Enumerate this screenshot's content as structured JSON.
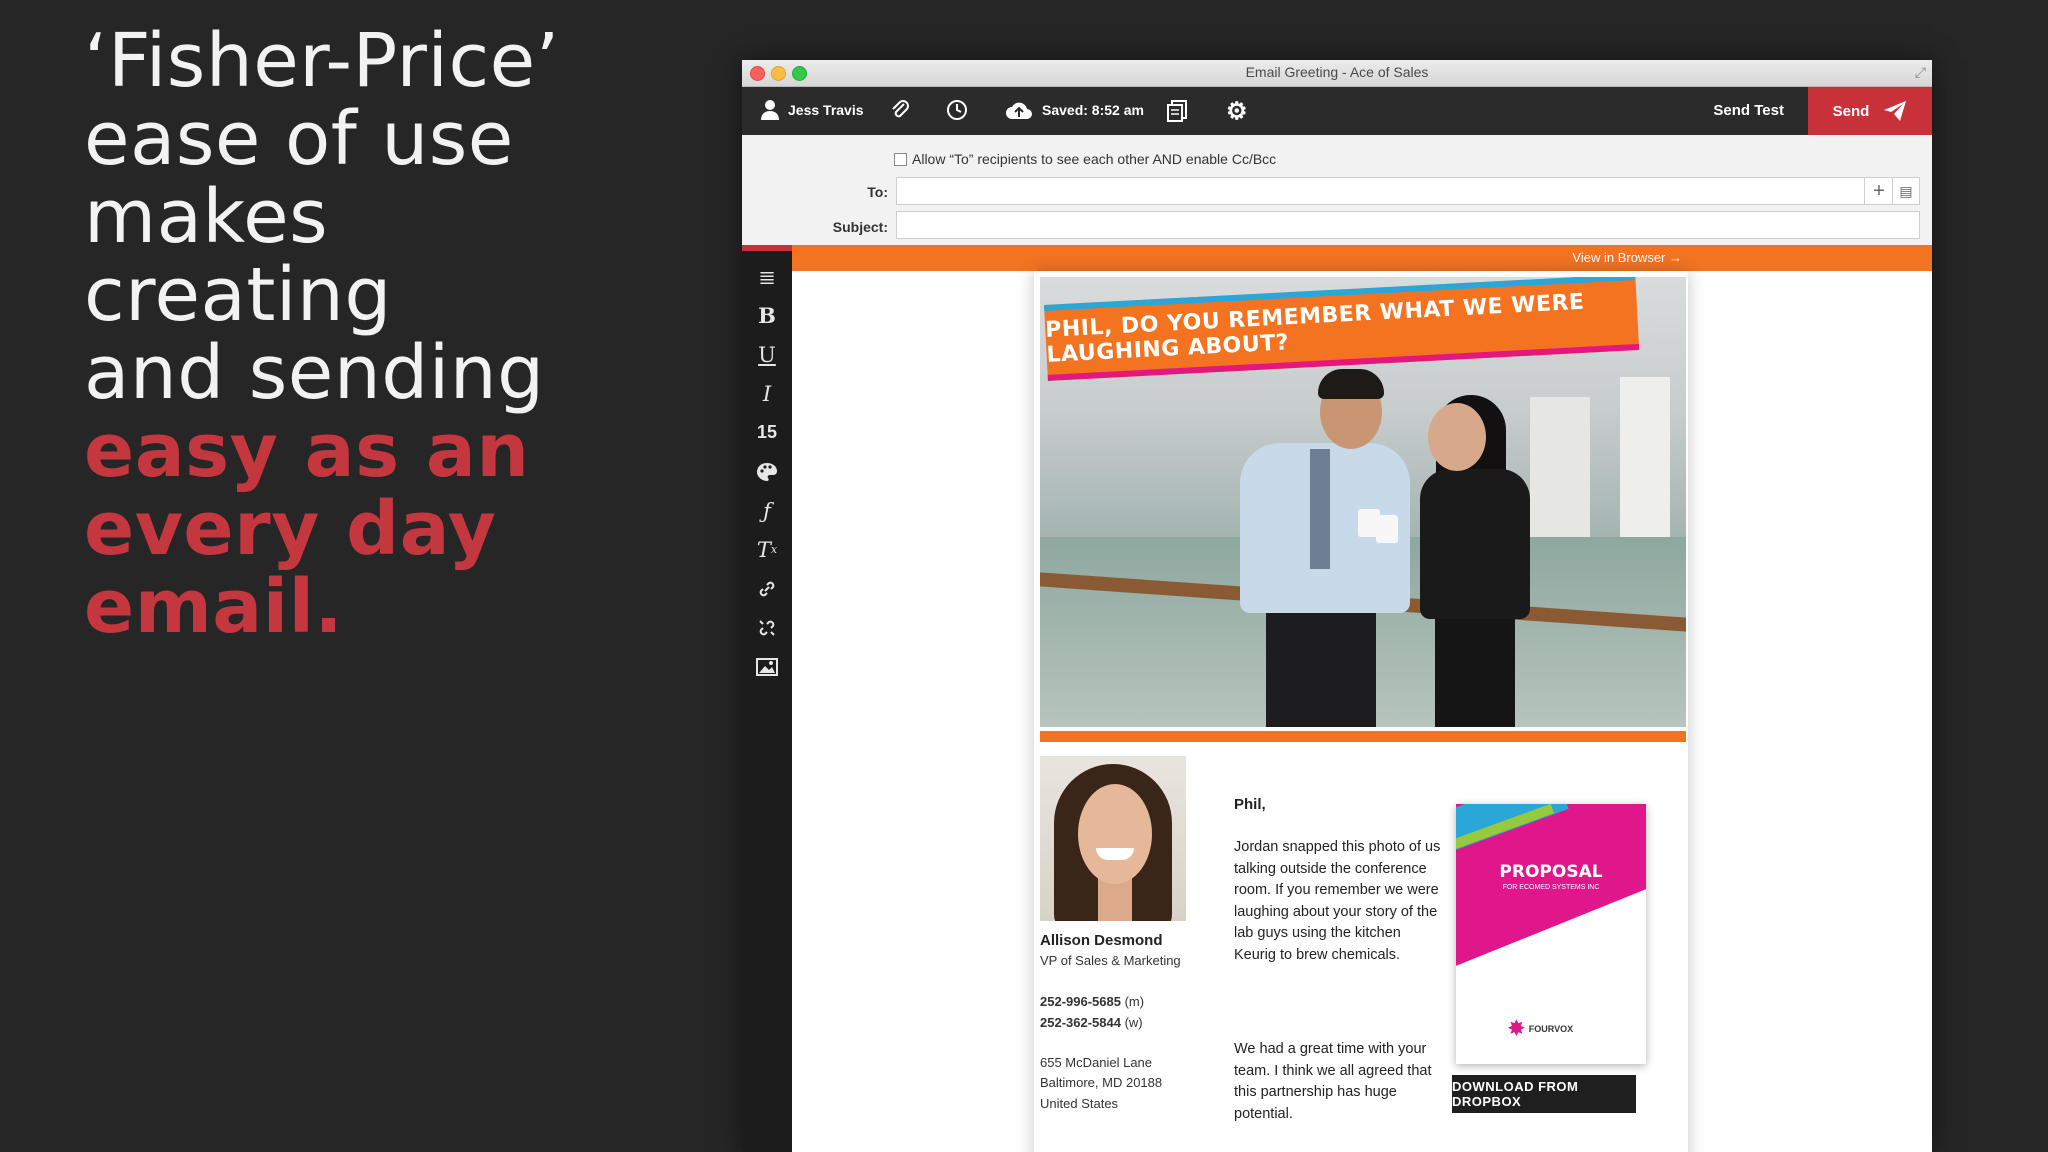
{
  "slide": {
    "lines": [
      "‘Fisher-Price’",
      "ease of use",
      "makes",
      "creating",
      "and sending"
    ],
    "accent_lines": [
      "easy as an",
      "every day",
      "email."
    ],
    "accent_color": "#c4373f"
  },
  "window": {
    "title": "Email Greeting - Ace of Sales"
  },
  "toolbar": {
    "user_name": "Jess Travis",
    "saved_label": "Saved: 8:52 am",
    "send_test_label": "Send Test",
    "send_label": "Send",
    "send_color": "#c8313a"
  },
  "fields": {
    "allow_text": "Allow “To” recipients to see each other AND enable Cc/Bcc",
    "to_label": "To:",
    "subject_label": "Subject:",
    "to_value": "",
    "subject_value": ""
  },
  "editor": {
    "view_in_browser": "View in Browser →",
    "font_size": "15",
    "accent_color": "#f47321",
    "sidebar_icons": [
      "align-icon",
      "bold-icon",
      "underline-icon",
      "italic-icon",
      "font-size",
      "palette-icon",
      "font-icon",
      "clear-format-icon",
      "link-icon",
      "unlink-icon",
      "image-icon"
    ]
  },
  "email": {
    "banner": "PHIL, DO YOU REMEMBER WHAT WE WERE LAUGHING ABOUT?",
    "signature": {
      "name": "Allison Desmond",
      "title": "VP of Sales & Marketing",
      "phone_m": "252-996-5685",
      "phone_m_suffix": " (m)",
      "phone_w": "252-362-5844",
      "phone_w_suffix": " (w)",
      "address1": "655 McDaniel Lane",
      "address2": "Baltimore, MD 20188",
      "address3": "United States"
    },
    "greeting": "Phil,",
    "paragraph1": "Jordan snapped this photo of us talking outside the conference room. If you remember we were laughing about your story of the lab guys using the kitchen Keurig to brew chemicals.",
    "paragraph2": "We had a great time with your team. I think we all agreed that this partnership has huge potential.",
    "proposal": {
      "title": "PROPOSAL",
      "subtitle": "FOR ECOMED SYSTEMS INC",
      "logo": "FOURVOX",
      "button": "DOWNLOAD FROM DROPBOX"
    }
  }
}
